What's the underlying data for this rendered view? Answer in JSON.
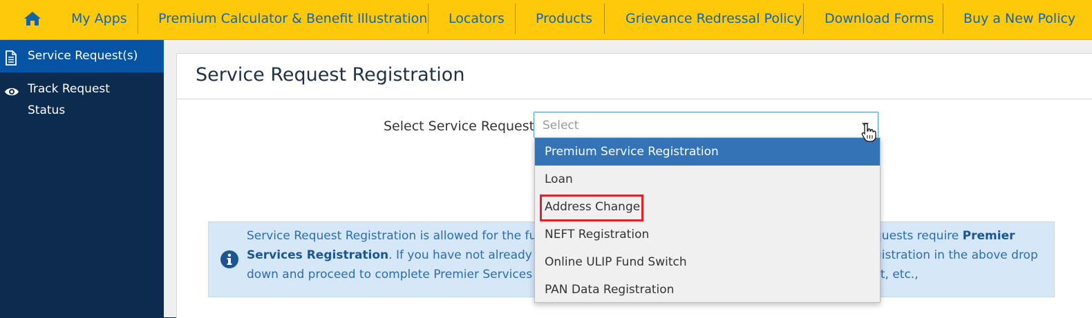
{
  "nav": {
    "home_icon": "home-icon",
    "items": [
      {
        "label": "My Apps"
      },
      {
        "label": "Premium Calculator & Benefit Illustration"
      },
      {
        "label": "Locators"
      },
      {
        "label": "Products"
      },
      {
        "label": "Grievance Redressal Policy"
      },
      {
        "label": "Download Forms"
      },
      {
        "label": "Buy a New Policy"
      }
    ]
  },
  "sidebar": {
    "items": [
      {
        "label": "Service Request(s)",
        "icon": "document-icon",
        "active": true
      },
      {
        "label_line1": "Track Request",
        "label_line2": "Status",
        "icon": "eye-icon"
      }
    ]
  },
  "page": {
    "title": "Service Request Registration",
    "select_label": "Select Service Request",
    "select_placeholder": "Select"
  },
  "dropdown": {
    "options": [
      {
        "label": "Premium Service Registration",
        "selected": true
      },
      {
        "label": "Loan"
      },
      {
        "label": "Address Change",
        "highlighted": true
      },
      {
        "label": "NEFT Registration"
      },
      {
        "label": "Online ULIP Fund Switch"
      },
      {
        "label": "PAN Data Registration"
      }
    ]
  },
  "info": {
    "icon": "info-icon",
    "text_1a": "Service Request Registration is allowed for the funct",
    "text_1b": "quests require",
    "bold_1": "Premier",
    "bold_2": "Services Registration",
    "text_2a": ". If you have not already enro",
    "text_2b": "gistration in the above drop",
    "text_3a": "down and proceed to complete Premier Services Re",
    "text_3b": "st, etc.,"
  },
  "colors": {
    "nav_bg": "#fdc90a",
    "nav_text": "#1464a8",
    "sidebar_bg": "#0c2b4f",
    "sidebar_active": "#0754a5",
    "selected_option": "#3473b5",
    "highlight_border": "#e0202a",
    "info_bg": "#d6e7f8"
  }
}
